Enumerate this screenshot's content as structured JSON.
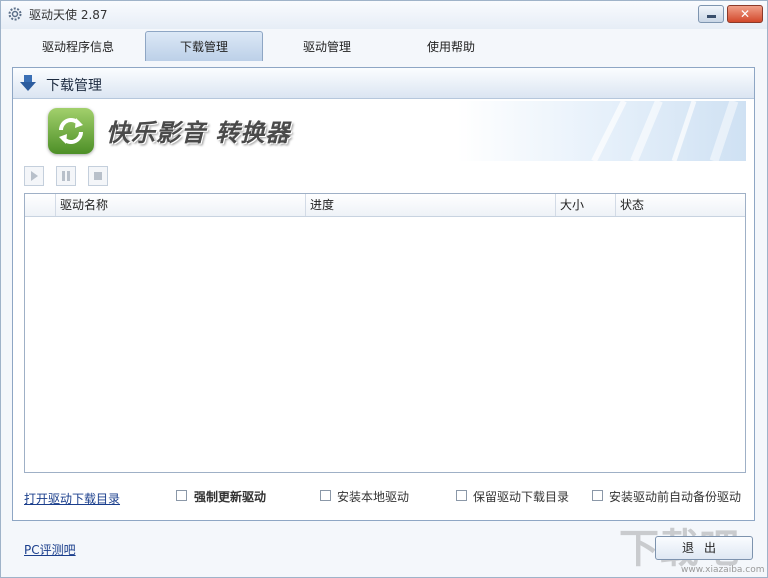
{
  "window": {
    "title": "驱动天使 2.87",
    "close_glyph": "✕"
  },
  "tabs": [
    {
      "label": "驱动程序信息"
    },
    {
      "label": "下载管理",
      "active": true
    },
    {
      "label": "驱动管理"
    },
    {
      "label": "使用帮助"
    }
  ],
  "panel": {
    "title": "下载管理",
    "banner_text": "快乐影音 转换器",
    "toolbar": {
      "play": "play-icon",
      "pause": "pause-icon",
      "stop": "stop-icon"
    },
    "columns": [
      "",
      "驱动名称",
      "进度",
      "大小",
      "状态"
    ]
  },
  "options": {
    "open_dir_link": "打开驱动下载目录",
    "force_update": {
      "label": "强制更新驱动",
      "checked": false
    },
    "install_local": {
      "label": "安装本地驱动",
      "checked": false
    },
    "keep_downloads": {
      "label": "保留驱动下载目录",
      "checked": false
    },
    "auto_backup": {
      "label": "安装驱动前自动备份驱动",
      "checked": false
    }
  },
  "footer": {
    "link": "PC评测吧",
    "exit_label": "退出"
  },
  "watermark": {
    "text": "下载吧",
    "url": "www.xiazaiba.com"
  },
  "colors": {
    "accent": "#8ea6c4",
    "link": "#1a3e8c",
    "close": "#d2492c"
  }
}
